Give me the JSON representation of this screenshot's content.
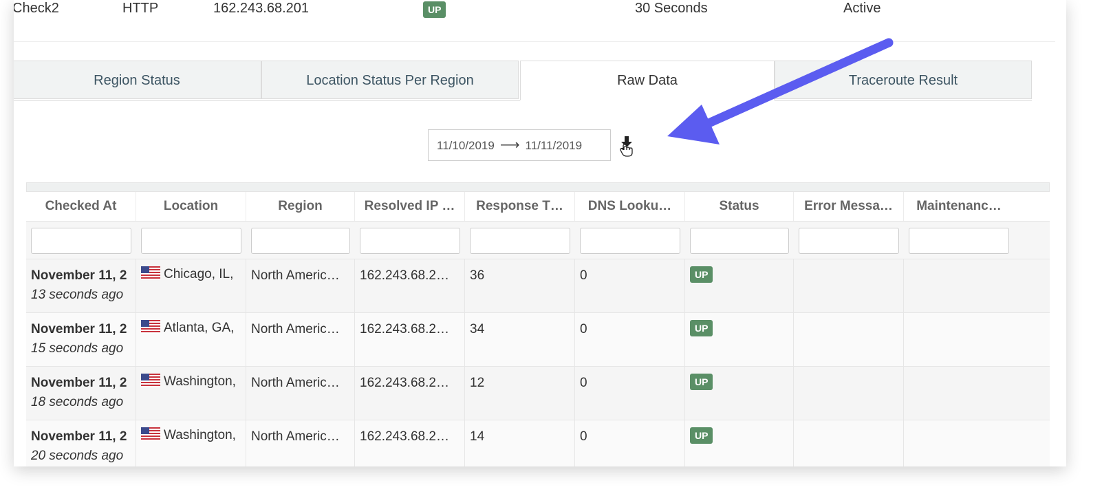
{
  "top_row": {
    "name": "Check2",
    "protocol": "HTTP",
    "ip": "162.243.68.201",
    "status": "UP",
    "interval": "30 Seconds",
    "state": "Active"
  },
  "tabs": [
    {
      "label": "Region Status",
      "active": false
    },
    {
      "label": "Location Status Per Region",
      "active": false
    },
    {
      "label": "Raw Data",
      "active": true
    },
    {
      "label": "Traceroute Result",
      "active": false
    }
  ],
  "date_range": {
    "start": "11/10/2019",
    "arrow": "⟶",
    "end": "11/11/2019"
  },
  "download_icon": "download-icon",
  "table": {
    "columns": [
      "Checked At",
      "Location",
      "Region",
      "Resolved IP …",
      "Response T…",
      "DNS Looku…",
      "Status",
      "Error Messa…",
      "Maintenanc…"
    ],
    "rows": [
      {
        "checked_at": "November 11, 2",
        "ago": "13 seconds ago",
        "location": "Chicago, IL,",
        "region": "North Americ…",
        "ip": "162.243.68.2…",
        "response": "36",
        "dns": "0",
        "status": "UP",
        "error": "",
        "maintenance": ""
      },
      {
        "checked_at": "November 11, 2",
        "ago": "15 seconds ago",
        "location": "Atlanta, GA,",
        "region": "North Americ…",
        "ip": "162.243.68.2…",
        "response": "34",
        "dns": "0",
        "status": "UP",
        "error": "",
        "maintenance": ""
      },
      {
        "checked_at": "November 11, 2",
        "ago": "18 seconds ago",
        "location": "Washington,",
        "region": "North Americ…",
        "ip": "162.243.68.2…",
        "response": "12",
        "dns": "0",
        "status": "UP",
        "error": "",
        "maintenance": ""
      },
      {
        "checked_at": "November 11, 2",
        "ago": "20 seconds ago",
        "location": "Washington,",
        "region": "North Americ…",
        "ip": "162.243.68.2…",
        "response": "14",
        "dns": "0",
        "status": "UP",
        "error": "",
        "maintenance": ""
      }
    ]
  },
  "colors": {
    "badge": "#5a8f66",
    "annotation_arrow": "#5b5cf0",
    "tab_text": "#3d5563"
  }
}
